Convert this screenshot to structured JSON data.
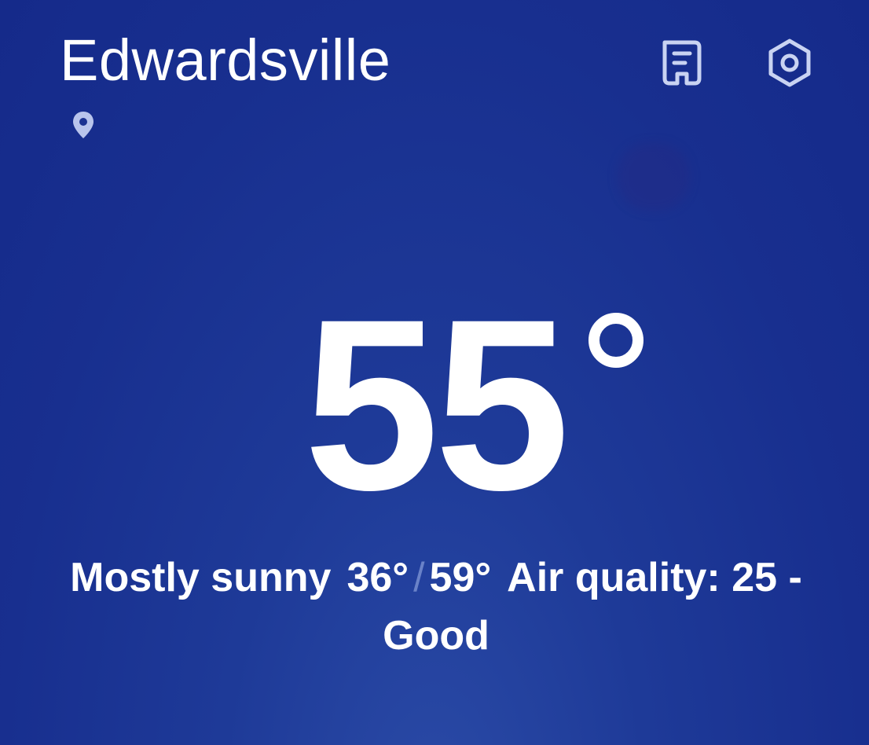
{
  "header": {
    "city": "Edwardsville",
    "location_icon": "location-pin-icon",
    "news_icon": "news-icon",
    "settings_icon": "settings-hex-icon"
  },
  "current": {
    "temperature": "55",
    "condition": "Mostly sunny",
    "low": "36°",
    "separator": "/",
    "high": "59°",
    "air_quality": "Air quality: 25 - Good"
  },
  "colors": {
    "background": "#1a3190",
    "text": "#ffffff",
    "icon": "#c9d3f2",
    "separator": "#6a82c8"
  }
}
